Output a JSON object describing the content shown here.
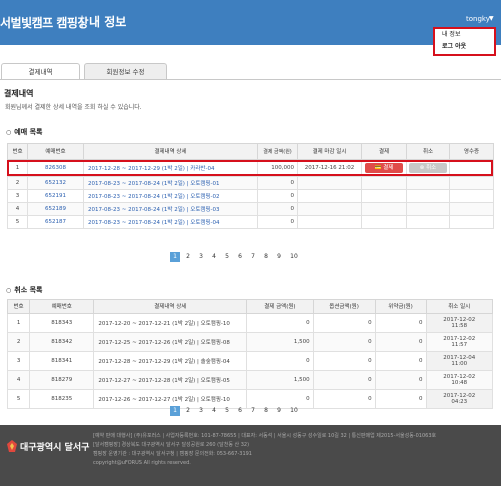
{
  "header": {
    "site_title": "서벌빛캠프 캠핑장",
    "separator": "|",
    "page_title": "내 정보",
    "username": "tongky",
    "caret": "▼"
  },
  "user_menu": {
    "items": [
      "내 정보",
      "로그 아웃"
    ]
  },
  "tabs": [
    "결제내역",
    "회원정보 수정"
  ],
  "section": {
    "title": "결제내역",
    "description": "회원님께서 결제한 상세 내역을 조회 하실 수 있습니다."
  },
  "reservations": {
    "heading": "예매 목록",
    "columns": [
      "번호",
      "예매번호",
      "결제내역 상세",
      "결제 금액(원)",
      "결제 마감 일시",
      "결제",
      "취소",
      "영수증"
    ],
    "pay_label": "결제",
    "cancel_label": "취소",
    "rows": [
      {
        "no": "1",
        "id": "826308",
        "detail": "2017-12-28 ~ 2017-12-29 (1박 2일) | 카라반-04",
        "amount": "100,000",
        "deadline": "2017-12-16 21:02",
        "actions": true
      },
      {
        "no": "2",
        "id": "652132",
        "detail": "2017-08-23 ~ 2017-08-24 (1박 2일) | 오토캠핑-01",
        "amount": "0",
        "deadline": "",
        "actions": false
      },
      {
        "no": "3",
        "id": "652191",
        "detail": "2017-08-23 ~ 2017-08-24 (1박 2일) | 오토캠핑-02",
        "amount": "0",
        "deadline": "",
        "actions": false
      },
      {
        "no": "4",
        "id": "652189",
        "detail": "2017-08-23 ~ 2017-08-24 (1박 2일) | 오토캠핑-03",
        "amount": "0",
        "deadline": "",
        "actions": false
      },
      {
        "no": "5",
        "id": "652187",
        "detail": "2017-08-23 ~ 2017-08-24 (1박 2일) | 오토캠핑-04",
        "amount": "0",
        "deadline": "",
        "actions": false
      }
    ]
  },
  "pagination_1": [
    "1",
    "2",
    "3",
    "4",
    "5",
    "6",
    "7",
    "8",
    "9",
    "10"
  ],
  "cancellations": {
    "heading": "취소 목록",
    "columns": [
      "번호",
      "예매번호",
      "결제내역 상세",
      "결제 금액(원)",
      "옵션금액(원)",
      "위약금(원)",
      "취소 일시"
    ],
    "rows": [
      {
        "no": "1",
        "id": "818343",
        "detail": "2017-12-20 ~ 2017-12-21 (1박 2일) | 오토캠핑-10",
        "amount": "0",
        "option": "0",
        "penalty": "0",
        "date": "2017-12-02",
        "time": "11:58"
      },
      {
        "no": "2",
        "id": "818342",
        "detail": "2017-12-25 ~ 2017-12-26 (1박 2일) | 오토캠핑-08",
        "amount": "1,500",
        "option": "0",
        "penalty": "0",
        "date": "2017-12-02",
        "time": "11:57"
      },
      {
        "no": "3",
        "id": "818341",
        "detail": "2017-12-28 ~ 2017-12-29 (1박 2일) | 솔숲캠핑-04",
        "amount": "0",
        "option": "0",
        "penalty": "0",
        "date": "2017-12-04",
        "time": "11:00"
      },
      {
        "no": "4",
        "id": "818279",
        "detail": "2017-12-27 ~ 2017-12-28 (1박 2일) | 오토캠핑-05",
        "amount": "1,500",
        "option": "0",
        "penalty": "0",
        "date": "2017-12-02",
        "time": "10:48"
      },
      {
        "no": "5",
        "id": "818235",
        "detail": "2017-12-26 ~ 2017-12-27 (1박 2일) | 오토캠핑-10",
        "amount": "0",
        "option": "0",
        "penalty": "0",
        "date": "2017-12-02",
        "time": "04:23"
      }
    ]
  },
  "pagination_2": [
    "1",
    "2",
    "3",
    "4",
    "5",
    "6",
    "7",
    "8",
    "9",
    "10"
  ],
  "footer": {
    "logo_text": "대구광역시 달서구",
    "lines": [
      "[예약 판매 대행사] (주)유포러스 | 사업자등록번호: 101-87-78655 | 대표자: 서동석 | 서울시 성동구 성수일로 10길 32 | 통신판매업 제2015-서울성동-01063호",
      "[달서캠핑장] 경상북도 대구광역시 달서구 달성공원로 260 (달천동 산 32)",
      "캠핑장 운영기관 : 대구광역시 달서구청 | 캠핑장 문의전화: 053-667-3191",
      "copyright@uFORUS All rights reserved."
    ]
  },
  "colors": {
    "header_bg": "#3e7fbf",
    "highlight": "#d6101c",
    "pay_button": "#e04b49",
    "cancel_button": "#c8c8c8",
    "footer_bg": "#4a4a4a",
    "link_blue": "#2a5fb0",
    "active_page": "#5aa0d8"
  }
}
